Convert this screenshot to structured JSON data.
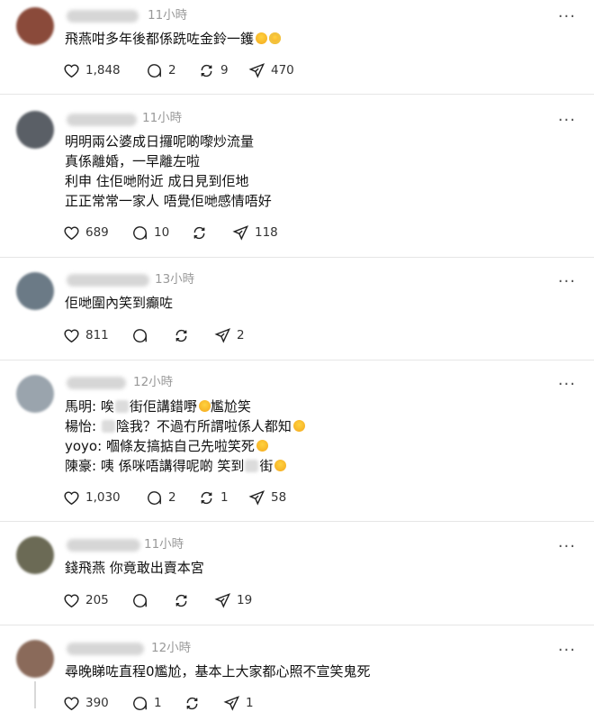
{
  "posts": [
    {
      "time": "11小時",
      "lines": [
        [
          "飛燕咁多年後都係跣咗金鈴一鑊"
        ]
      ],
      "emoji": [
        "smile",
        "hearts"
      ],
      "likes": "1,848",
      "replies": "2",
      "reposts": "9",
      "shares": "470",
      "avatar_color": "#8a4a3a"
    },
    {
      "time": "11小時",
      "lines": [
        [
          "明明兩公婆成日攞呢啲嚟炒流量"
        ],
        [
          "真係離婚，一早離左啦"
        ],
        [
          "利申 住佢哋附近 成日見到佢地"
        ],
        [
          "正正常常一家人 唔覺佢哋感情唔好"
        ]
      ],
      "likes": "689",
      "replies": "10",
      "reposts": "",
      "shares": "118",
      "avatar_color": "#5a5f66"
    },
    {
      "time": "13小時",
      "lines": [
        [
          "佢哋圍內笑到癲咗"
        ]
      ],
      "likes": "811",
      "replies": "",
      "reposts": "",
      "shares": "2",
      "avatar_color": "#6b7a86"
    },
    {
      "time": "12小時",
      "lines": [
        [
          "馬明: 唉",
          "街佢講錯嘢",
          "尷尬笑"
        ],
        [
          "楊怡: ",
          "陰我？不過冇所謂啦係人都知"
        ],
        [
          "yoyo: 嗰條友搞掂自己先啦笑死"
        ],
        [
          "陳豪: 咦 係咪唔講得呢啲 笑到",
          "街"
        ]
      ],
      "likes": "1,030",
      "replies": "2",
      "reposts": "1",
      "shares": "58",
      "avatar_color": "#9aa4ad"
    },
    {
      "time": "11小時",
      "lines": [
        [
          "錢飛燕 你竟敢出賣本宮"
        ]
      ],
      "likes": "205",
      "replies": "",
      "reposts": "",
      "shares": "19",
      "avatar_color": "#6b6a55"
    },
    {
      "time": "12小時",
      "lines": [
        [
          "尋晚睇咗直程0尷尬，基本上大家都心照不宣笑鬼死"
        ]
      ],
      "likes": "390",
      "replies": "1",
      "reposts": "",
      "shares": "1",
      "avatar_color": "#8a6a5a"
    }
  ],
  "icons": {
    "more": "more-icon",
    "like": "heart-icon",
    "reply": "reply-icon",
    "repost": "repost-icon",
    "share": "share-icon"
  }
}
